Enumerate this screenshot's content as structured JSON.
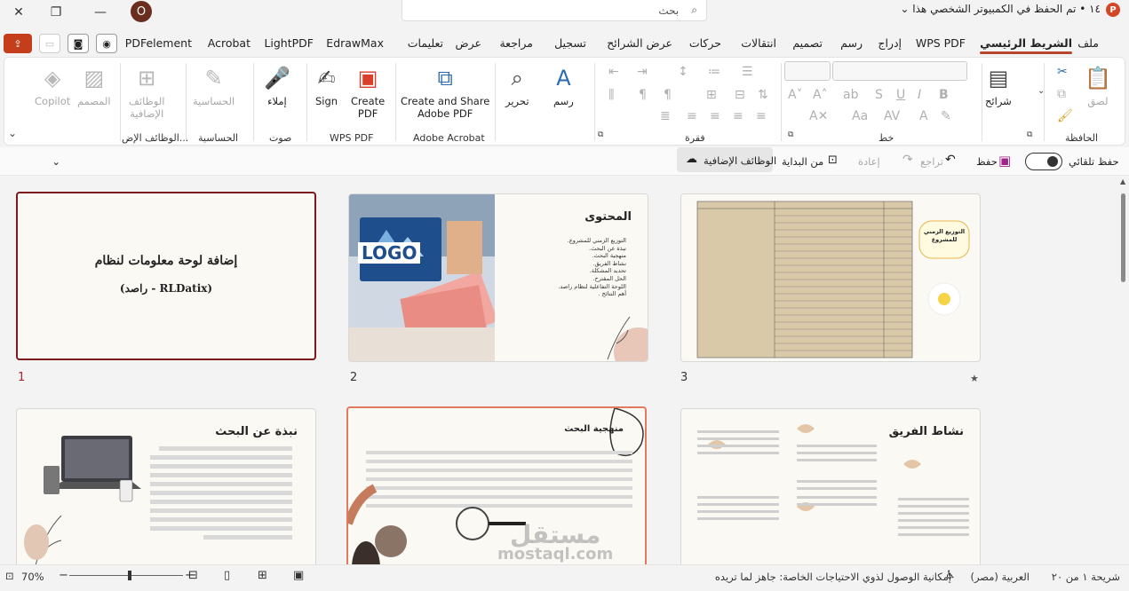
{
  "titlebar": {
    "doc_title": "١٤ • تم الحفظ في الكمبيوتر الشخصي هذا",
    "chevron": "⌄",
    "search_placeholder": "بحث",
    "avatar_letter": "O",
    "app_icon_letter": "P"
  },
  "tabs": [
    {
      "label": "ملف"
    },
    {
      "label": "الشريط الرئيسي"
    },
    {
      "label": "WPS PDF"
    },
    {
      "label": "إدراج"
    },
    {
      "label": "رسم"
    },
    {
      "label": "تصميم"
    },
    {
      "label": "انتقالات"
    },
    {
      "label": "حركات"
    },
    {
      "label": "عرض الشرائح"
    },
    {
      "label": "تسجيل"
    },
    {
      "label": "مراجعة"
    },
    {
      "label": "عرض"
    },
    {
      "label": "تعليمات"
    },
    {
      "label": "EdrawMax"
    },
    {
      "label": "LightPDF"
    },
    {
      "label": "Acrobat"
    },
    {
      "label": "PDFelement"
    }
  ],
  "ribbon": {
    "groups": {
      "clipboard": "الحافظة",
      "font": "خط",
      "paragraph": "فقرة",
      "adobe": "Adobe Acrobat",
      "wps": "WPS PDF",
      "voice": "صوت",
      "sensitivity": "الحساسية",
      "addins": "الوظائف الإض..."
    },
    "buttons": {
      "paste": "لصق",
      "slides": "شرائح",
      "draw": "رسم",
      "editing": "تحرير",
      "create_share": "Create and Share",
      "create_share_2": "Adobe PDF",
      "create_pdf": "Create",
      "create_pdf_2": "PDF",
      "sign": "Sign",
      "dictate": "إملاء",
      "sensitivity": "الحساسية",
      "addins_1": "الوظائف",
      "addins_2": "الإضافية",
      "designer": "المصمم",
      "copilot": "Copilot"
    }
  },
  "toolbar2": {
    "autosave": "حفظ تلقائي",
    "save": "حفظ",
    "undo": "تراجع",
    "redo": "إعادة",
    "from_start": "من البداية",
    "addins": "الوظائف الإضافية"
  },
  "slides": [
    {
      "num": "1",
      "title": "إضافة لوحة معلومات لنظام",
      "subtitle": "(راصد - RLDatix)"
    },
    {
      "num": "2",
      "title": "المحتوى",
      "items": [
        "التوزيع الزمني للمشروع.",
        "نبذة عن البحث.",
        "منهجية البحث.",
        "نشاط الفريق.",
        "تحديد المشكلة.",
        "الحل المقترح.",
        "اللوحة التفاعلية لنظام راصد.",
        "أهم النتائج ."
      ],
      "logo": "LOGO"
    },
    {
      "num": "3",
      "bubble": "التوزيع الزمني للمشروع",
      "star": "★"
    },
    {
      "num": "4",
      "title": "نبذة عن البحث"
    },
    {
      "num": "5",
      "title": "منهجية البحث"
    },
    {
      "num": "6",
      "title": "نشاط الفريق"
    }
  ],
  "statusbar": {
    "slide_of": "شريحة ١ من ٢٠",
    "language": "العربية (مصر)",
    "accessibility": "إمكانية الوصول لذوي الاحتياجات الخاصة: جاهز لما تريده",
    "zoom": "70%"
  },
  "watermark": {
    "line1": "مستقل",
    "line2": "mostaql.com"
  },
  "colors": {
    "accent": "#b7472a",
    "selected_slide": "#7a1b1b",
    "ppt": "#d24726"
  }
}
